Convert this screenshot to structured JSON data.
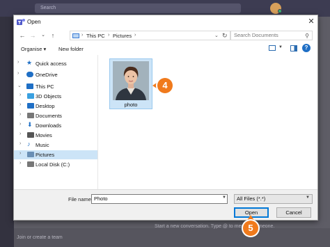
{
  "background_app": {
    "search_placeholder": "Search",
    "conversation_hint": "Start a new conversation. Type @ to mention someone.",
    "team_hint": "Join or create a team"
  },
  "dialog": {
    "title": "Open",
    "close_glyph": "✕",
    "nav": {
      "back": "←",
      "forward": "→",
      "up_dropdown": "⌄",
      "up": "↑"
    },
    "breadcrumb": [
      "This PC",
      "Pictures"
    ],
    "breadcrumb_sep": "›",
    "refresh": "↻",
    "search_placeholder": "Search Documents",
    "toolbar": {
      "organise": "Organise ▾",
      "new_folder": "New folder",
      "help": "?"
    },
    "tree": [
      {
        "label": "Quick access",
        "icon": "star-icon",
        "color": "#1f6fc5"
      },
      {
        "label": "OneDrive",
        "icon": "cloud-icon",
        "color": "#1f6fc5"
      },
      {
        "label": "This PC",
        "icon": "computer-icon",
        "color": "#1f6fc5"
      },
      {
        "label": "3D Objects",
        "icon": "cube-icon",
        "color": "#3aa0e0"
      },
      {
        "label": "Desktop",
        "icon": "desktop-icon",
        "color": "#1f6fc5"
      },
      {
        "label": "Documents",
        "icon": "document-icon",
        "color": "#777777"
      },
      {
        "label": "Downloads",
        "icon": "download-icon",
        "color": "#1f6fc5"
      },
      {
        "label": "Movies",
        "icon": "film-icon",
        "color": "#555555"
      },
      {
        "label": "Music",
        "icon": "music-icon",
        "color": "#1f6fc5"
      },
      {
        "label": "Pictures",
        "icon": "pictures-icon",
        "color": "#6a8fb5"
      },
      {
        "label": "Local Disk (C:)",
        "icon": "drive-icon",
        "color": "#777777"
      }
    ],
    "file": {
      "name": "photo"
    },
    "file_name_label": "File name:",
    "file_name_value": "Photo",
    "file_type": "All Files (*.*)",
    "open_label": "Open",
    "cancel_label": "Cancel"
  },
  "callouts": {
    "step4": "4",
    "step5": "5"
  },
  "colors": {
    "accent": "#0078d7",
    "selection": "#cce4f7",
    "callout": "#f07a1c"
  }
}
